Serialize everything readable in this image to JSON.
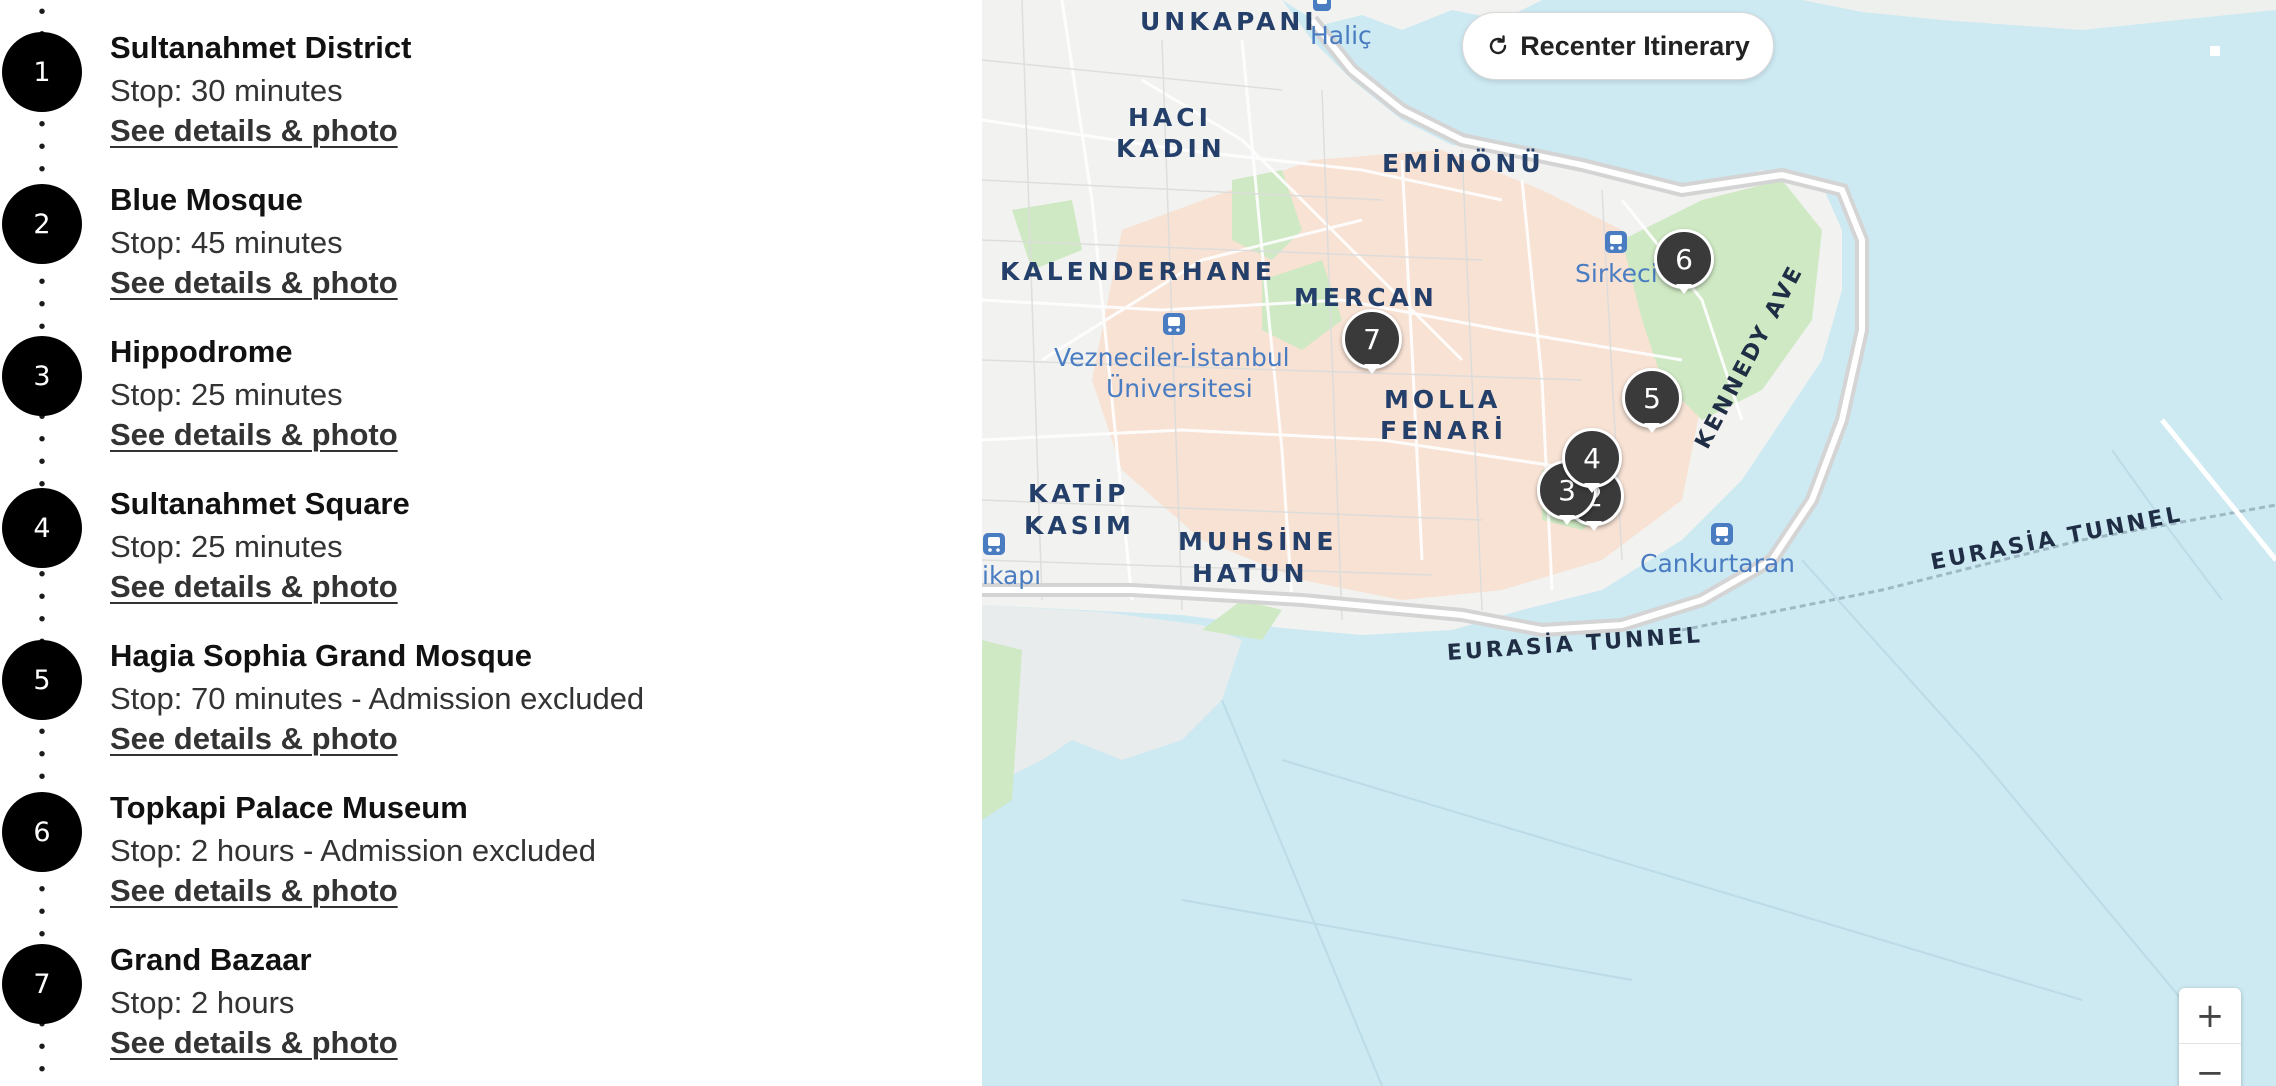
{
  "itinerary": {
    "stops": [
      {
        "number": "1",
        "name": "Sultanahmet District",
        "duration": "Stop: 30 minutes",
        "link": "See details & photo"
      },
      {
        "number": "2",
        "name": "Blue Mosque",
        "duration": "Stop: 45 minutes",
        "link": "See details & photo"
      },
      {
        "number": "3",
        "name": "Hippodrome",
        "duration": "Stop: 25 minutes",
        "link": "See details & photo"
      },
      {
        "number": "4",
        "name": "Sultanahmet Square",
        "duration": "Stop: 25 minutes",
        "link": "See details & photo"
      },
      {
        "number": "5",
        "name": "Hagia Sophia Grand Mosque",
        "duration": "Stop: 70 minutes - Admission excluded",
        "link": "See details & photo"
      },
      {
        "number": "6",
        "name": "Topkapi Palace Museum",
        "duration": "Stop: 2 hours - Admission excluded",
        "link": "See details & photo"
      },
      {
        "number": "7",
        "name": "Grand Bazaar",
        "duration": "Stop: 2 hours",
        "link": "See details & photo"
      }
    ]
  },
  "map": {
    "recenter_label": "Recenter Itinerary",
    "recenter_icon": "refresh-icon",
    "zoom_in_label": "+",
    "zoom_out_label": "−",
    "labels": {
      "unkapani": "UNKAPANI",
      "halic": "Haliç",
      "haci": "HACI",
      "kadin": "KADIN",
      "eminonu": "EMİNÖNÜ",
      "sirkeci": "Sirkeci",
      "kalenderhane": "KALENDERHANE",
      "mercan": "MERCAN",
      "vezneciler_1": "Vezneciler-İstanbul",
      "vezneciler_2": "Üniversitesi",
      "molla": "MOLLA",
      "fenari": "FENARİ",
      "katip": "KATİP",
      "kasim": "KASIM",
      "muhsine": "MUHSİNE",
      "hatun": "HATUN",
      "ikapi": "ikapı",
      "cankurtaran": "Cankurtaran",
      "kennedy": "KENNEDY AVE",
      "eurasia_1": "EURASİA TUNNEL",
      "eurasia_2": "EURASİA TUNNEL"
    },
    "markers": [
      "7",
      "6",
      "5",
      "3",
      "2",
      "4"
    ],
    "colors": {
      "water": "#cde9f2",
      "land": "#f2f2f0",
      "district": "#f8dccb",
      "park": "#cfe9c4",
      "marker": "#3a3a3a"
    }
  }
}
